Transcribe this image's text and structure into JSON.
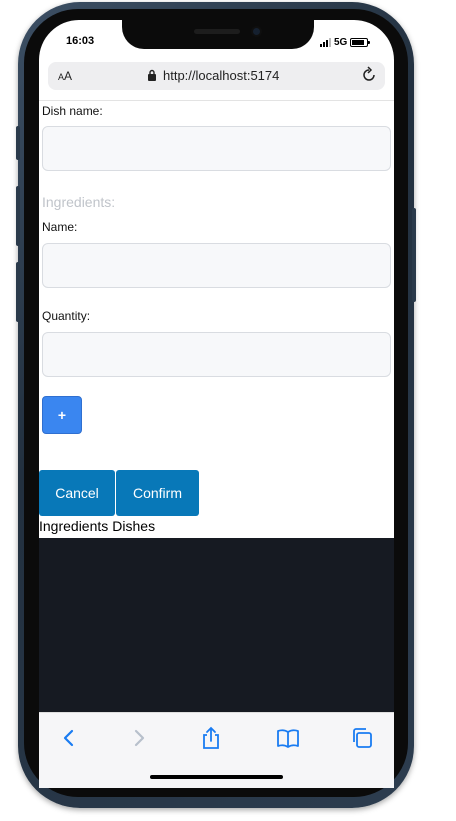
{
  "status_bar": {
    "time": "16:03",
    "network": "5G"
  },
  "browser": {
    "text_size_label": "AA",
    "url": "http://localhost:5174"
  },
  "form": {
    "dish_name_label": "Dish name:",
    "ingredients_heading": "Ingredients:",
    "ingredient_name_label": "Name:",
    "quantity_label": "Quantity:",
    "add_label": "+",
    "cancel_label": "Cancel",
    "confirm_label": "Confirm"
  },
  "nav": {
    "items": [
      "Ingredients",
      "Dishes"
    ]
  },
  "colors": {
    "primary_button": "#0878b8",
    "add_button": "#3a86f0",
    "dark_panel": "#161a22",
    "safari_accent": "#1a7cf2"
  },
  "toolbar_icons": [
    "back-icon",
    "forward-icon",
    "share-icon",
    "bookmarks-icon",
    "tabs-icon"
  ]
}
